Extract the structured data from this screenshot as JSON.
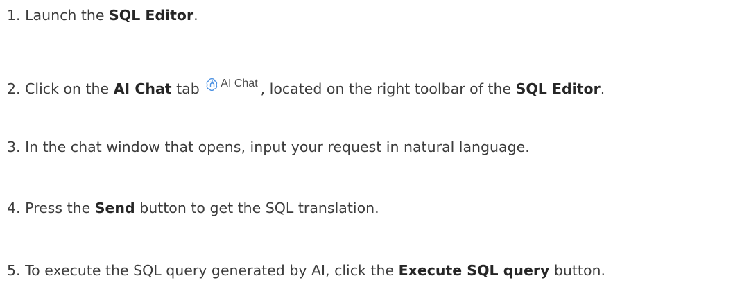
{
  "steps": [
    {
      "number": "1.",
      "t1": "Launch the",
      "b1": "SQL Editor",
      "t2": "."
    },
    {
      "number": "2.",
      "t1": "Click on the",
      "b1": "AI Chat",
      "t2": "tab",
      "chip_label": "AI Chat",
      "t3": ", located on the right toolbar of the",
      "b2": "SQL Editor",
      "t4": "."
    },
    {
      "number": "3.",
      "t1": "In the chat window that opens, input your request in natural language."
    },
    {
      "number": "4.",
      "t1": "Press the",
      "b1": "Send",
      "t2": "button to get the SQL translation."
    },
    {
      "number": "5.",
      "t1": "To execute the SQL query generated by AI, click the",
      "b1": "Execute SQL query",
      "t2": "button."
    }
  ],
  "icons": {
    "chip_icon": "ai-chat-icon",
    "chip_icon_color": "#4a90e2"
  }
}
